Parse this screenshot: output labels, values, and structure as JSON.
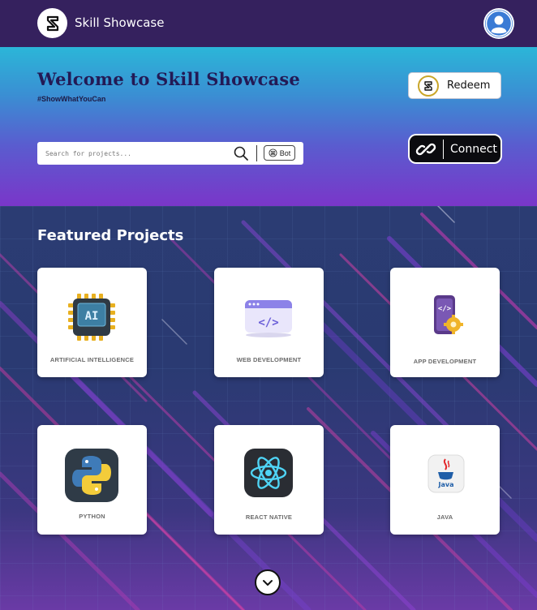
{
  "header": {
    "app_title": "Skill Showcase",
    "logo_icon": "skill-showcase-logo-icon",
    "avatar_icon": "user-avatar-icon"
  },
  "hero": {
    "title": "Welcome to Skill Showcase",
    "tagline": "#ShowWhatYouCan",
    "redeem_label": "Redeem",
    "connect_label": "Connect",
    "search": {
      "placeholder": "Search for projects..."
    },
    "bot_label": "Bot",
    "colors": {
      "gradient_top": "#2bb6d8",
      "gradient_bottom": "#7a36c9",
      "navbar": "#35215e"
    }
  },
  "featured": {
    "title": "Featured Projects",
    "projects": [
      {
        "label": "ARTIFICIAL INTELLIGENCE",
        "icon": "ai-chip-icon"
      },
      {
        "label": "WEB DEVELOPMENT",
        "icon": "web-code-window-icon"
      },
      {
        "label": "APP DEVELOPMENT",
        "icon": "app-code-gear-icon"
      },
      {
        "label": "PYTHON",
        "icon": "python-logo-icon"
      },
      {
        "label": "REACT NATIVE",
        "icon": "react-logo-icon"
      },
      {
        "label": "JAVA",
        "icon": "java-logo-icon"
      }
    ]
  }
}
